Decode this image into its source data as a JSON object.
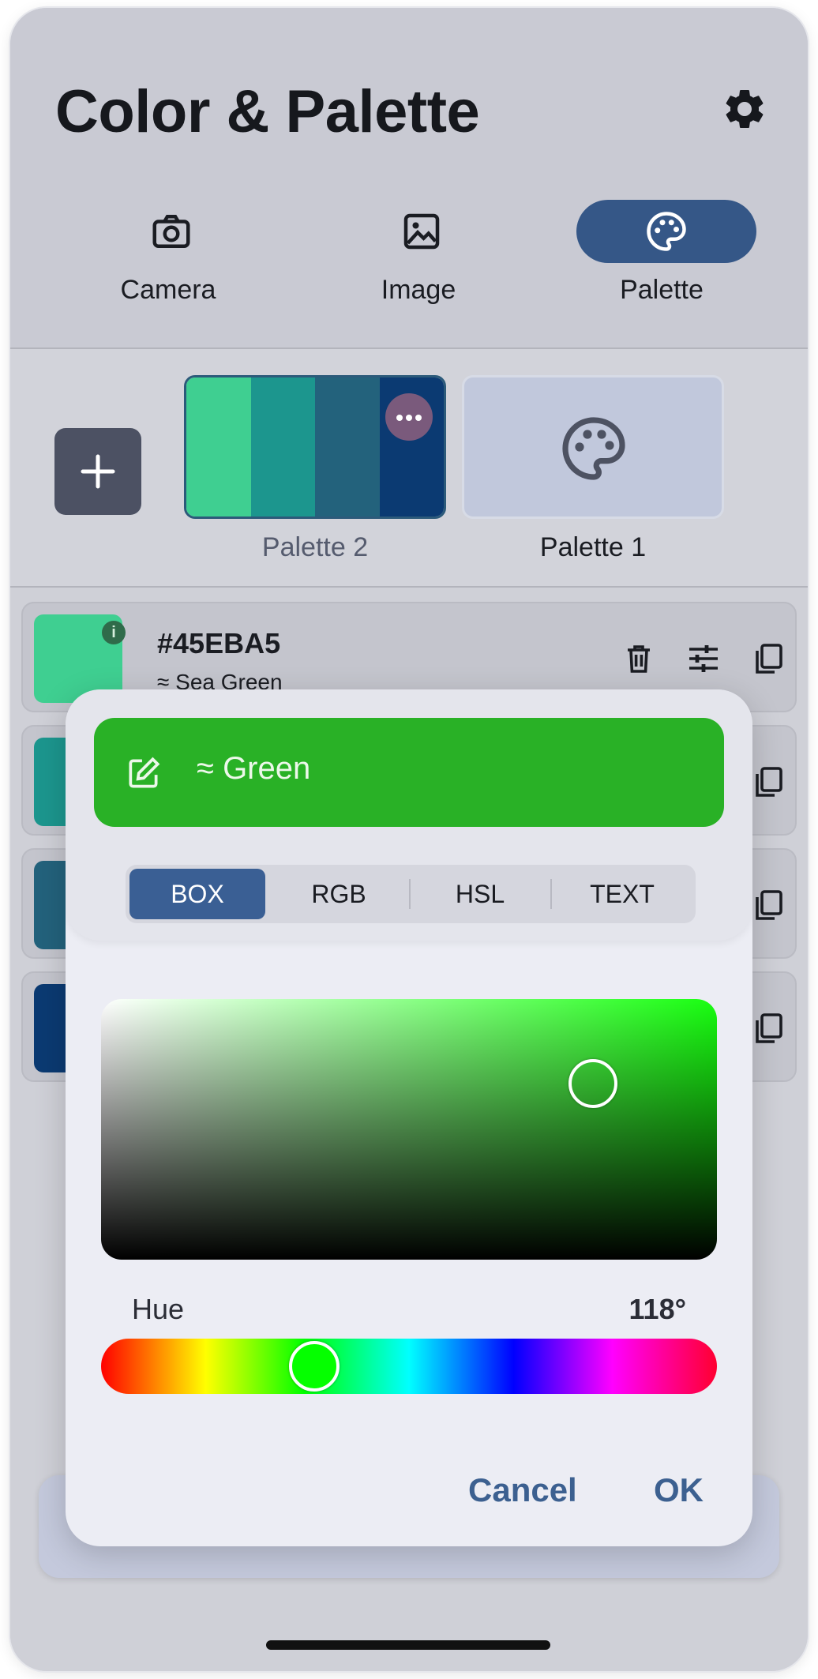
{
  "app": {
    "title": "Color & Palette"
  },
  "tabs": [
    {
      "label": "Camera",
      "icon": "camera-icon",
      "active": false
    },
    {
      "label": "Image",
      "icon": "image-icon",
      "active": false
    },
    {
      "label": "Palette",
      "icon": "palette-icon",
      "active": true
    }
  ],
  "palettes": [
    {
      "label": "Palette 2",
      "colors": [
        "#3fcf91",
        "#1c968e",
        "#23627c",
        "#0b3a72"
      ],
      "selected": true
    },
    {
      "label": "Palette 1",
      "colors": [],
      "selected": false
    }
  ],
  "colors": [
    {
      "hex": "#45EBA5",
      "name": "≈ Sea Green",
      "swatch": "#3fcf91",
      "info_badge": "i"
    },
    {
      "hex": "",
      "name": "",
      "swatch": "#1c968e"
    },
    {
      "hex": "",
      "name": "",
      "swatch": "#23627c"
    },
    {
      "hex": "",
      "name": "",
      "swatch": "#0b3a72"
    }
  ],
  "picker": {
    "color_name": "≈ Green",
    "preview_color": "#29b126",
    "modes": [
      "BOX",
      "RGB",
      "HSL",
      "TEXT"
    ],
    "active_mode": "BOX",
    "saturation": 0.8,
    "value": 0.67,
    "hue_label": "Hue",
    "hue_value": "118°",
    "hue_degrees": 118,
    "cancel_label": "Cancel",
    "ok_label": "OK"
  },
  "colors_theme": {
    "accent": "#355787",
    "background": "#d4d5dc"
  }
}
